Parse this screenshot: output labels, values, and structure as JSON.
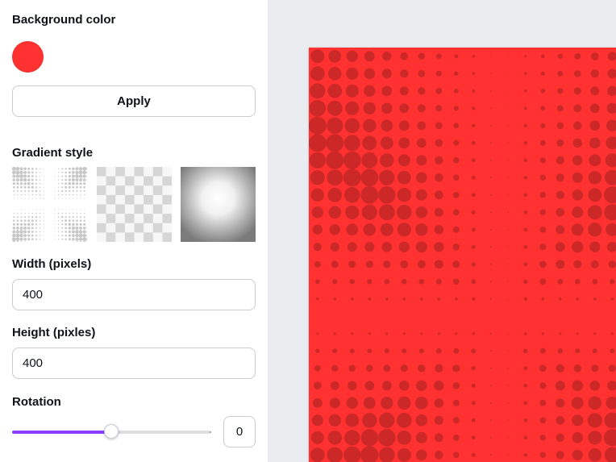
{
  "panel": {
    "background_color_label": "Background color",
    "selected_color": "#ff3131",
    "apply_label": "Apply",
    "gradient_style_label": "Gradient style",
    "gradient_styles": [
      "halftone-burst",
      "transparent-checker",
      "radial-vignette"
    ],
    "width_label": "Width (pixels)",
    "width_value": "400",
    "height_label": "Height (pixles)",
    "height_value": "400",
    "rotation_label": "Rotation",
    "rotation_value": "0",
    "rotation_slider_fraction": 0.5
  },
  "canvas": {
    "background": "#ff3131",
    "dot_color": "#cc2828",
    "pattern": "halftone-burst"
  },
  "colors": {
    "accent": "#8b3dff",
    "workspace": "#ebecf0"
  }
}
